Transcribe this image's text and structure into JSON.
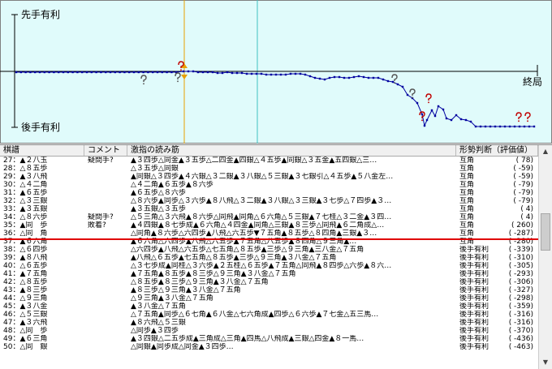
{
  "graph": {
    "top_label": "先手有利",
    "bottom_label": "後手有利",
    "end_label": "終局",
    "colors": {
      "bg": "#e0fbfb",
      "line": "#0000a0",
      "grid": "#40c0c0",
      "cursor": "#e8a000",
      "mark": "#c00000"
    }
  },
  "header": {
    "col_move": "棋譜",
    "col_comment": "コメント",
    "col_pv": "激指の読み筋",
    "col_eval": "形勢判断（評価値）"
  },
  "rows": [
    {
      "move": "27：▲２八玉",
      "comment": "疑問手?",
      "pv": "▲３四歩△同金▲３五歩△二四金▲四銀△４五歩▲同銀△３五金▲五四銀△三…",
      "judge": "互角",
      "score": "(    78)"
    },
    {
      "move": "28：△８五歩",
      "comment": "",
      "pv": "△３五歩△同銀",
      "judge": "互角",
      "score": "(   -59)"
    },
    {
      "move": "29：▲３八飛",
      "comment": "",
      "pv": "▲同銀△３四歩▲４六銀△３二銀▲３八銀△５三銀▲３七銀引△４五歩▲５八金左…",
      "judge": "互角",
      "score": "(   -59)"
    },
    {
      "move": "30：△４二角",
      "comment": "",
      "pv": "△４二角▲６五歩▲８六歩",
      "judge": "互角",
      "score": "(   -79)"
    },
    {
      "move": "31：▲６五歩",
      "comment": "",
      "pv": "▲６五歩△８六歩",
      "judge": "互角",
      "score": "(   -79)"
    },
    {
      "move": "32：△３三銀",
      "comment": "",
      "pv": "△８六歩▲同歩△３六歩▲８八飛△３二銀▲３八銀△３三銀▲３七歩△７四歩▲３…",
      "judge": "互角",
      "score": "(   -79)"
    },
    {
      "move": "33：▲３五銀",
      "comment": "",
      "pv": "▲３五銀△３五歩",
      "judge": "互角",
      "score": "(     4)"
    },
    {
      "move": "34：△８六歩",
      "comment": "疑問手?",
      "pv": "△５三角△３六飛▲８六歩△同飛▲同角△６六角△５三銀▲７七桂△３二金▲３四…",
      "judge": "互角",
      "score": "(     4)"
    },
    {
      "move": "35：▲同　歩",
      "comment": "敗着?",
      "pv": "▲４四銀▲８七歩成▲６六角△４四金▲同角△三銀▲８三歩△同飛▲６二角成△…",
      "judge": "互角",
      "score": "(   260)"
    },
    {
      "move": "36：△同　角",
      "comment": "",
      "pv": "△同角▲８六歩△六四歩▲八飛△六五歩▼７五角▲８五歩△８四角▲三銀▲３…",
      "judge": "互角",
      "score": "(  -287)"
    },
    {
      "move": "37：▲６六角",
      "comment": "",
      "pv": "▲６六角△六四歩▲八飛△六五歩▲７五角△八五歩▲８四角△９三角▲…",
      "judge": "互角",
      "score": "(  -280)"
    },
    {
      "move": "38：△６四歩",
      "comment": "",
      "pv": "△六四歩▲八飛△六五歩△七五角△８五歩▲三歩△９三角▲三八金△７五角",
      "judge": "後手有利",
      "score": "(  -339)"
    },
    {
      "move": "39：▲８八飛",
      "comment": "",
      "pv": "▲八飛△６五歩▲七五角△８五歩▲三歩△９三角▲３八金△７五角",
      "judge": "後手有利",
      "score": "(  -310)"
    },
    {
      "move": "40：△６五歩",
      "comment": "",
      "pv": "△３七歩成▲同桂△３六歩▲２五桂△６五歩▲７五角△同飛▲８四歩△六歩▲８六…",
      "judge": "後手有利",
      "score": "(  -305)"
    },
    {
      "move": "41：▲７五角",
      "comment": "",
      "pv": "▲７五角▲８五歩▲８三歩△９三角▲３八金△７五角",
      "judge": "後手有利",
      "score": "(  -293)"
    },
    {
      "move": "42：△８五歩",
      "comment": "",
      "pv": "△８五歩▲８三歩△９三角▲３八金△７五角",
      "judge": "後手有利",
      "score": "(  -306)"
    },
    {
      "move": "43：▲８三歩",
      "comment": "",
      "pv": "▲８三歩△９三角▲３八金△７五角",
      "judge": "後手有利",
      "score": "(  -327)"
    },
    {
      "move": "44：△９三角",
      "comment": "",
      "pv": "△９三角▲３八金△７五角",
      "judge": "後手有利",
      "score": "(  -298)"
    },
    {
      "move": "45：▲３八金",
      "comment": "",
      "pv": "▲３八金△７五角",
      "judge": "後手有利",
      "score": "(  -359)"
    },
    {
      "move": "46：△５三銀",
      "comment": "",
      "pv": "△７五角▲同歩△６七角▲６八金△七六角成▲四歩△６六歩▲７七金△五三馬…",
      "judge": "後手有利",
      "score": "(  -316)"
    },
    {
      "move": "47：▲３六飛",
      "comment": "",
      "pv": "▲８六飛△５三銀",
      "judge": "後手有利",
      "score": "(  -316)"
    },
    {
      "move": "48：△同　歩",
      "comment": "",
      "pv": "△同歩▲３四歩",
      "judge": "後手有利",
      "score": "(  -370)"
    },
    {
      "move": "49：▲６三角",
      "comment": "",
      "pv": "▲３四銀△二五歩成▲三角成△三角▲四馬△八飛成▲三銀△四金▲８一馬…",
      "judge": "後手有利",
      "score": "(  -436)"
    },
    {
      "move": "50：△同　銀",
      "comment": "",
      "pv": "△同銀▲同歩成△同金▲３四歩…",
      "judge": "後手有利",
      "score": "(  -463)"
    }
  ]
}
